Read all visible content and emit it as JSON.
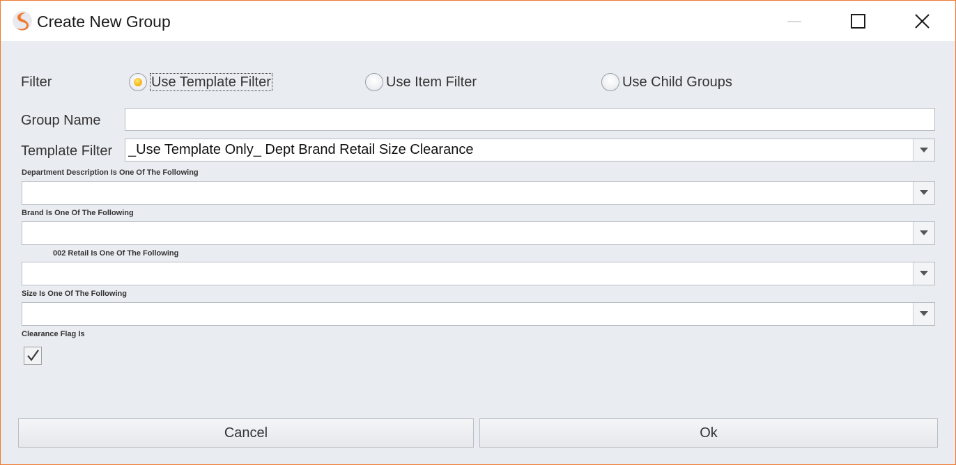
{
  "window": {
    "title": "Create New Group",
    "border_color": "#f0792e",
    "logo": "app-logo-s-icon",
    "controls": [
      "minimize-icon",
      "maximize-icon",
      "close-icon"
    ]
  },
  "filter": {
    "label": "Filter",
    "options": [
      {
        "label": "Use Template Filter",
        "selected": true
      },
      {
        "label": "Use Item Filter",
        "selected": false
      },
      {
        "label": "Use Child Groups",
        "selected": false
      }
    ]
  },
  "group_name": {
    "label": "Group Name",
    "value": ""
  },
  "template_filter": {
    "label": "Template Filter",
    "value": "_Use Template Only_ Dept Brand Retail Size Clearance"
  },
  "criteria": [
    {
      "label": "Department Description Is One Of The Following",
      "value": ""
    },
    {
      "label": "Brand Is One Of The Following",
      "value": ""
    },
    {
      "label": "002 Retail Is One Of The Following",
      "value": ""
    },
    {
      "label": "Size Is One Of The Following",
      "value": ""
    }
  ],
  "clearance": {
    "label": "Clearance Flag Is",
    "checked": true
  },
  "buttons": {
    "cancel": "Cancel",
    "ok": "Ok"
  },
  "colors": {
    "radio_selected": "#f6b91a",
    "background": "#e9ecf1"
  }
}
